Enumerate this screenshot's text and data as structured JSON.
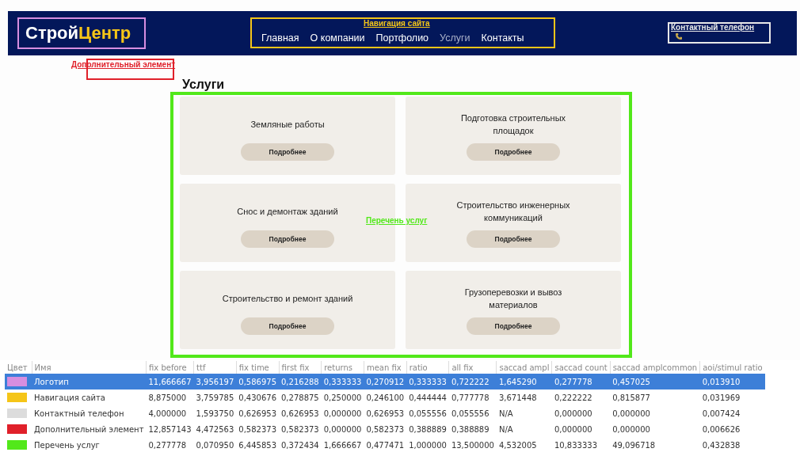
{
  "site": {
    "logo": {
      "first": "Строй",
      "second": "Центр"
    },
    "nav": [
      {
        "label": "Главная",
        "selected": false
      },
      {
        "label": "О компании",
        "selected": false
      },
      {
        "label": "Портфолио",
        "selected": false
      },
      {
        "label": "Услуги",
        "selected": true
      },
      {
        "label": "Контакты",
        "selected": false
      }
    ],
    "section_title": "Услуги",
    "services": [
      {
        "title": "Земляные работы",
        "button": "Подробнее"
      },
      {
        "title": "Подготовка строительных площадок",
        "button": "Подробнее"
      },
      {
        "title": "Снос и демонтаж зданий",
        "button": "Подробнее"
      },
      {
        "title": "Строительство инженерных коммуникаций",
        "button": "Подробнее"
      },
      {
        "title": "Строительство и ремонт зданий",
        "button": "Подробнее"
      },
      {
        "title": "Грузоперевозки и вывоз материалов",
        "button": "Подробнее"
      }
    ]
  },
  "overlays": [
    {
      "kind": "logo",
      "color": "#d78ee0"
    },
    {
      "kind": "nav",
      "label": "Навигация сайта",
      "color": "#f5c518"
    },
    {
      "kind": "phone",
      "label": "Контактный телефон",
      "color": "#e8e8e8"
    },
    {
      "kind": "extra",
      "label": "Дополнительный элемент",
      "color": "#e0202a"
    },
    {
      "kind": "list",
      "label": "Перечень услуг",
      "color": "#52e81a"
    }
  ],
  "table": {
    "columns": [
      "Цвет",
      "Имя",
      "fix before",
      "ttf",
      "fix time",
      "first fix",
      "returns",
      "mean fix",
      "ratio",
      "all fix",
      "saccad ampl",
      "saccad count",
      "saccad amplcommon",
      "aoi/stimul ratio"
    ],
    "rows": [
      {
        "color": "#d78ee0",
        "name": "Логотип",
        "selected": true,
        "values": [
          "11,666667",
          "3,956197",
          "0,586975",
          "0,216288",
          "0,333333",
          "0,270912",
          "0,333333",
          "0,722222",
          "1,645290",
          "0,277778",
          "0,457025",
          "0,013910"
        ]
      },
      {
        "color": "#f5c518",
        "name": "Навигация сайта",
        "selected": false,
        "values": [
          "8,875000",
          "3,759785",
          "0,430676",
          "0,278875",
          "0,250000",
          "0,246100",
          "0,444444",
          "0,777778",
          "3,671448",
          "0,222222",
          "0,815877",
          "0,031969"
        ]
      },
      {
        "color": "#dcdcdc",
        "name": "Контактный телефон",
        "selected": false,
        "values": [
          "4,000000",
          "1,593750",
          "0,626953",
          "0,626953",
          "0,000000",
          "0,626953",
          "0,055556",
          "0,055556",
          "N/A",
          "0,000000",
          "0,000000",
          "0,007424"
        ]
      },
      {
        "color": "#e0202a",
        "name": "Дополнительный элемент",
        "selected": false,
        "values": [
          "12,857143",
          "4,472563",
          "0,582373",
          "0,582373",
          "0,000000",
          "0,582373",
          "0,388889",
          "0,388889",
          "N/A",
          "0,000000",
          "0,000000",
          "0,006626"
        ]
      },
      {
        "color": "#52e81a",
        "name": "Перечень услуг",
        "selected": false,
        "values": [
          "0,277778",
          "0,070950",
          "6,445853",
          "0,372434",
          "1,666667",
          "0,477471",
          "1,000000",
          "13,500000",
          "4,532005",
          "10,833333",
          "49,096718",
          "0,432838"
        ]
      }
    ]
  }
}
